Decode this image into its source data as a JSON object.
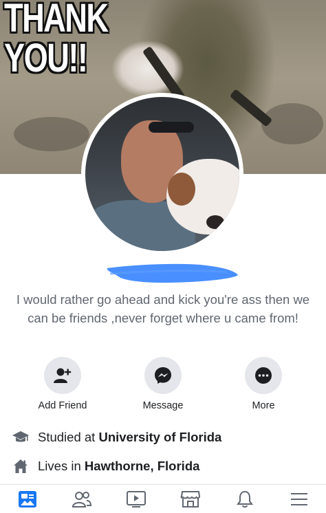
{
  "cover": {
    "overlay_text_line1": "THANK",
    "overlay_text_line2": "YOU!!"
  },
  "profile": {
    "name": "",
    "bio": "I would rather go ahead and kick you're ass then we can be friends ,never forget where u came from!"
  },
  "actions": [
    {
      "label": "Add Friend",
      "icon": "add-friend-icon"
    },
    {
      "label": "Message",
      "icon": "messenger-icon"
    },
    {
      "label": "More",
      "icon": "more-icon"
    }
  ],
  "details": {
    "education": {
      "prefix": "Studied at ",
      "value": "University of Florida",
      "icon": "graduation-cap-icon"
    },
    "residence": {
      "prefix": "Lives in ",
      "value": "Hawthorne, Florida",
      "icon": "home-icon"
    }
  },
  "tabbar": {
    "tabs": [
      {
        "name": "news-feed",
        "icon": "news-feed-icon",
        "active": true
      },
      {
        "name": "friends",
        "icon": "friends-icon",
        "active": false
      },
      {
        "name": "watch",
        "icon": "watch-icon",
        "active": false
      },
      {
        "name": "marketplace",
        "icon": "marketplace-icon",
        "active": false
      },
      {
        "name": "notifications",
        "icon": "bell-icon",
        "active": false
      },
      {
        "name": "menu",
        "icon": "menu-icon",
        "active": false
      }
    ]
  },
  "colors": {
    "accent_blue": "#1877f2",
    "redaction_blue": "#3a86ff",
    "button_bg": "#e4e6eb",
    "secondary_text": "#606770",
    "icon_gray": "#606770"
  }
}
